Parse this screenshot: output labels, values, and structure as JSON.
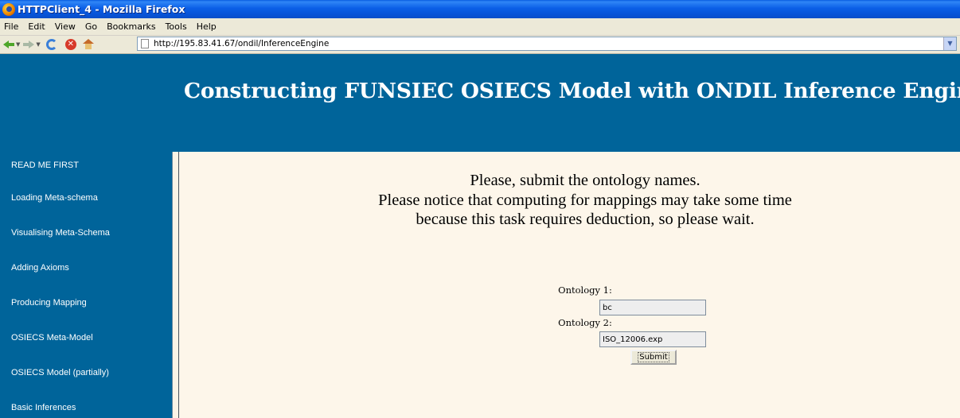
{
  "window": {
    "title": "HTTPClient_4 - Mozilla Firefox"
  },
  "menubar": {
    "items": [
      "File",
      "Edit",
      "View",
      "Go",
      "Bookmarks",
      "Tools",
      "Help"
    ]
  },
  "toolbar": {
    "url": "http://195.83.41.67/ondil/InferenceEngine",
    "icons": [
      "back-icon",
      "forward-icon",
      "reload-icon",
      "stop-icon",
      "home-icon",
      "page-icon"
    ]
  },
  "page": {
    "heading": "Constructing FUNSIEC OSIECS Model with ONDIL Inference Engine",
    "sidebar": {
      "items": [
        "READ ME FIRST",
        "Loading Meta-schema",
        "Visualising Meta-Schema",
        "Adding Axioms",
        "Producing Mapping",
        "OSIECS Meta-Model",
        "OSIECS Model (partially)",
        "Basic Inferences"
      ]
    },
    "message": {
      "line1": "Please, submit the ontology names.",
      "line2": "Please notice that computing for mappings may take some time",
      "line3": "because this task requires deduction, so please wait."
    },
    "form": {
      "ontology1_label": "Ontology 1:",
      "ontology1_value": "bc",
      "ontology2_label": "Ontology 2:",
      "ontology2_value": "ISO_12006.exp",
      "submit_label": "Submit"
    }
  },
  "colors": {
    "header_bg": "#00649a",
    "content_bg": "#fdf6ea",
    "titlebar": "#0a5de0"
  }
}
